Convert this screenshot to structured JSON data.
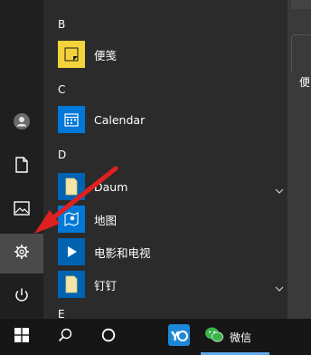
{
  "list": {
    "header_b": "B",
    "header_c": "C",
    "header_d": "D",
    "header_e": "E",
    "app_sticky": "便笺",
    "app_calendar": "Calendar",
    "app_daum": "Daum",
    "app_maps": "地图",
    "app_movies": "电影和电视",
    "app_dingtalk": "钉钉"
  },
  "right": {
    "partial_label": "便"
  },
  "taskbar": {
    "wechat_label": "微信"
  },
  "colors": {
    "accent": "#0078d7",
    "sticky_bg": "#f2d33b",
    "folder_tile": "#0063b1",
    "arrow": "#e02020"
  }
}
